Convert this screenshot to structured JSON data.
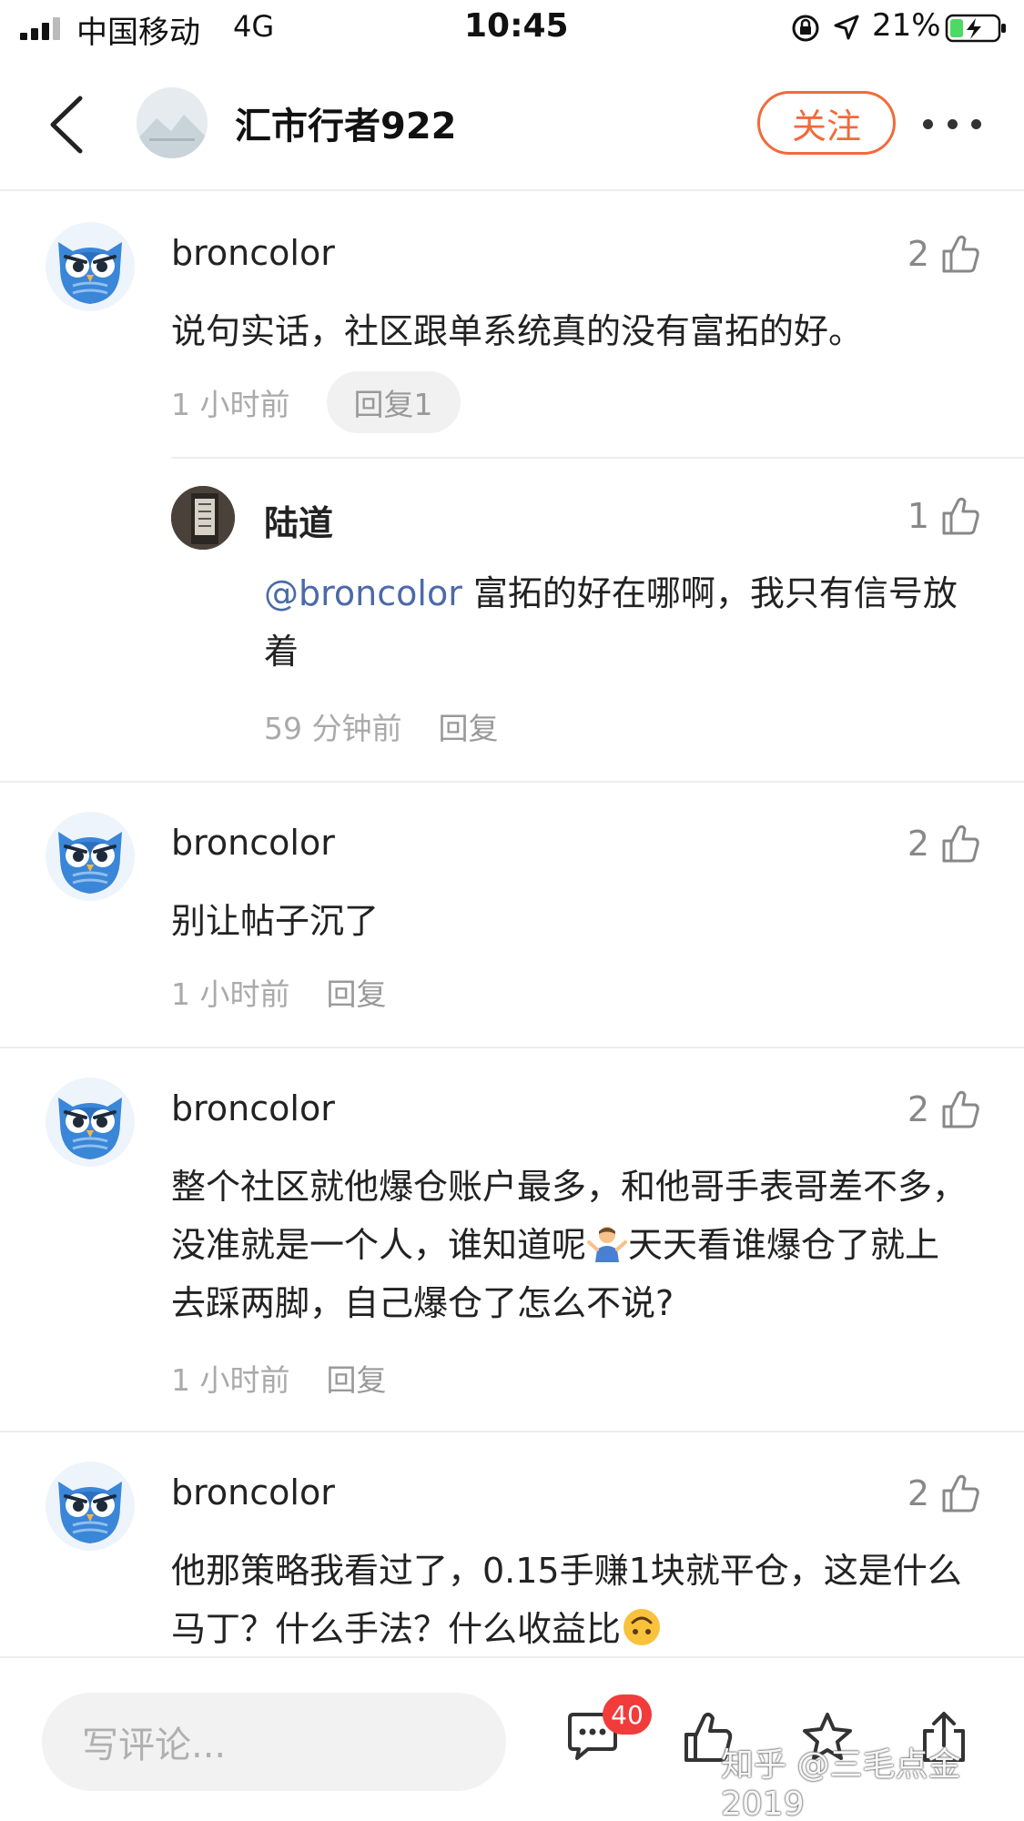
{
  "status_bar": {
    "carrier": "中国移动",
    "network": "4G",
    "time": "10:45",
    "battery_percent": "21%"
  },
  "nav": {
    "title": "汇市行者922",
    "follow_label": "关注"
  },
  "comments": [
    {
      "user": "broncolor",
      "likes": "2",
      "text": "说句实话，社区跟单系统真的没有富拓的好。",
      "time": "1 小时前",
      "reply_label": "回复1",
      "replies": [
        {
          "user": "陆道",
          "likes": "1",
          "mention": "@broncolor",
          "text": " 富拓的好在哪啊，我只有信号放着",
          "time": "59 分钟前",
          "reply_label": "回复"
        }
      ]
    },
    {
      "user": "broncolor",
      "likes": "2",
      "text": "别让帖子沉了",
      "time": "1 小时前",
      "reply_label": "回复"
    },
    {
      "user": "broncolor",
      "likes": "2",
      "text_part1": "整个社区就他爆仓账户最多，和他哥手表哥差不多，没准就是一个人，谁知道呢",
      "text_part2": "天天看谁爆仓了就上去踩两脚，自己爆仓了怎么不说?",
      "time": "1 小时前",
      "reply_label": "回复"
    },
    {
      "user": "broncolor",
      "likes": "2",
      "text": "他那策略我看过了，0.15手赚1块就平仓，这是什么马丁？什么手法？什么收益比",
      "time": "",
      "reply_label": ""
    }
  ],
  "bottom_bar": {
    "comment_placeholder": "写评论...",
    "comment_count": "40",
    "watermark": "知乎 @三毛点金2019"
  },
  "colors": {
    "accent": "#f26a3a",
    "mention": "#4b6aa8",
    "badge": "#f23b3b"
  }
}
